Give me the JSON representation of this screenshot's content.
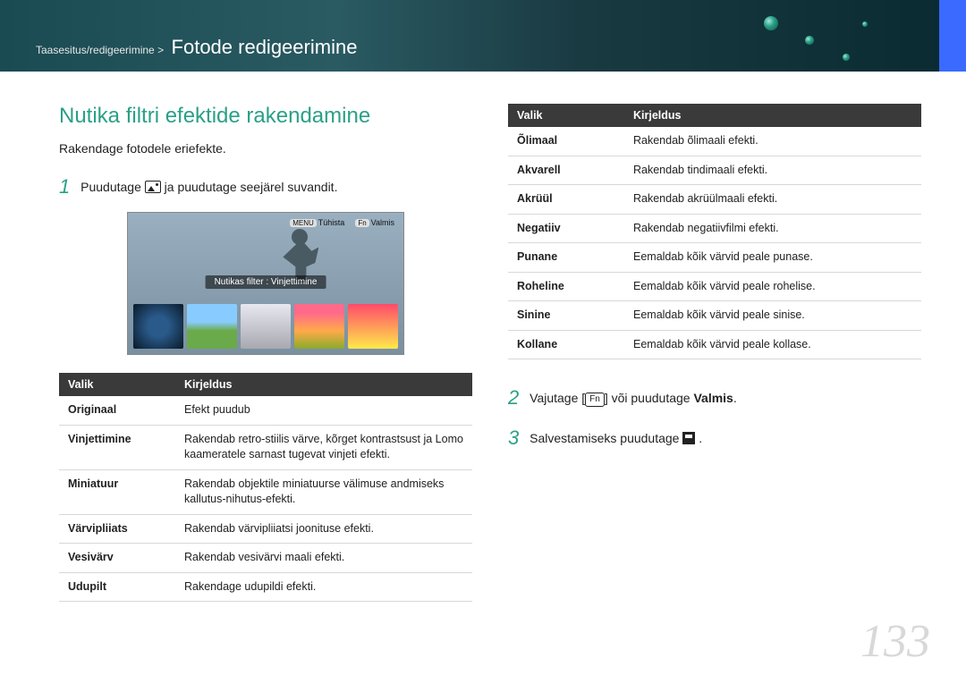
{
  "header": {
    "breadcrumb": "Taasesitus/redigeerimine >",
    "title": "Fotode redigeerimine"
  },
  "section_title": "Nutika filtri efektide rakendamine",
  "intro": "Rakendage fotodele eriefekte.",
  "step1_a": "Puudutage ",
  "step1_b": " ja puudutage seejärel suvandit.",
  "screenshot": {
    "menu_label": "MENU",
    "menu_text": "Tühista",
    "fn_label": "Fn",
    "fn_text": "Valmis",
    "filter_label": "Nutikas filter : Vinjettimine"
  },
  "table_header": {
    "option": "Valik",
    "desc": "Kirjeldus"
  },
  "table_left": [
    {
      "opt": "Originaal",
      "desc": "Efekt puudub"
    },
    {
      "opt": "Vinjettimine",
      "desc": "Rakendab retro-stiilis värve, kõrget kontrastsust ja Lomo kaameratele sarnast tugevat vinjeti efekti."
    },
    {
      "opt": "Miniatuur",
      "desc": "Rakendab objektile miniatuurse välimuse andmiseks kallutus-nihutus-efekti."
    },
    {
      "opt": "Värvipliiats",
      "desc": "Rakendab värvipliiatsi joonituse efekti."
    },
    {
      "opt": "Vesivärv",
      "desc": "Rakendab vesivärvi maali efekti."
    },
    {
      "opt": "Udupilt",
      "desc": "Rakendage udupildi efekti."
    }
  ],
  "table_right": [
    {
      "opt": "Õlimaal",
      "desc": "Rakendab õlimaali efekti."
    },
    {
      "opt": "Akvarell",
      "desc": "Rakendab tindimaali efekti."
    },
    {
      "opt": "Akrüül",
      "desc": "Rakendab akrüülmaali efekti."
    },
    {
      "opt": "Negatiiv",
      "desc": "Rakendab negatiivfilmi efekti."
    },
    {
      "opt": "Punane",
      "desc": "Eemaldab kõik värvid peale punase."
    },
    {
      "opt": "Roheline",
      "desc": "Eemaldab kõik värvid peale rohelise."
    },
    {
      "opt": "Sinine",
      "desc": "Eemaldab kõik värvid peale sinise."
    },
    {
      "opt": "Kollane",
      "desc": "Eemaldab kõik värvid peale kollase."
    }
  ],
  "step2_a": "Vajutage [",
  "step2_fn": "Fn",
  "step2_b": "] või puudutage ",
  "step2_bold": "Valmis",
  "step2_c": ".",
  "step3_a": "Salvestamiseks puudutage ",
  "step3_b": ".",
  "page_number": "133"
}
